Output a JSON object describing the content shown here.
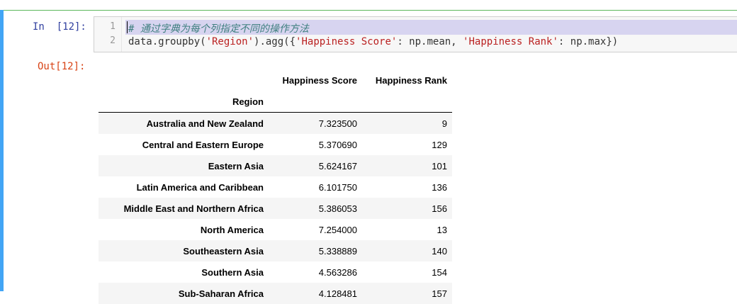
{
  "cell": {
    "in_prompt": "In  [12]:",
    "out_prompt": "Out[12]:",
    "line_numbers": [
      "1",
      "2"
    ],
    "code_comment": "# 通过字典为每个列指定不同的操作方法",
    "code": {
      "p1": "data.groupby(",
      "s1": "'Region'",
      "p2": ").agg({",
      "s2": "'Happiness Score'",
      "p3": ": np.mean, ",
      "s3": "'Happiness Rank'",
      "p4": ": np.max})"
    }
  },
  "table": {
    "columns": [
      "Happiness Score",
      "Happiness Rank"
    ],
    "index_name": "Region",
    "rows": [
      {
        "region": "Australia and New Zealand",
        "score": "7.323500",
        "rank": "9"
      },
      {
        "region": "Central and Eastern Europe",
        "score": "5.370690",
        "rank": "129"
      },
      {
        "region": "Eastern Asia",
        "score": "5.624167",
        "rank": "101"
      },
      {
        "region": "Latin America and Caribbean",
        "score": "6.101750",
        "rank": "136"
      },
      {
        "region": "Middle East and Northern Africa",
        "score": "5.386053",
        "rank": "156"
      },
      {
        "region": "North America",
        "score": "7.254000",
        "rank": "13"
      },
      {
        "region": "Southeastern Asia",
        "score": "5.338889",
        "rank": "140"
      },
      {
        "region": "Southern Asia",
        "score": "4.563286",
        "rank": "154"
      },
      {
        "region": "Sub-Saharan Africa",
        "score": "4.128481",
        "rank": "157"
      }
    ]
  },
  "colors": {
    "cell_border": "#5cb85c",
    "selected_bar": "#42a5f5",
    "in_prompt": "#303f9f",
    "out_prompt": "#d84315",
    "string": "#ba2121",
    "comment": "#408080"
  }
}
